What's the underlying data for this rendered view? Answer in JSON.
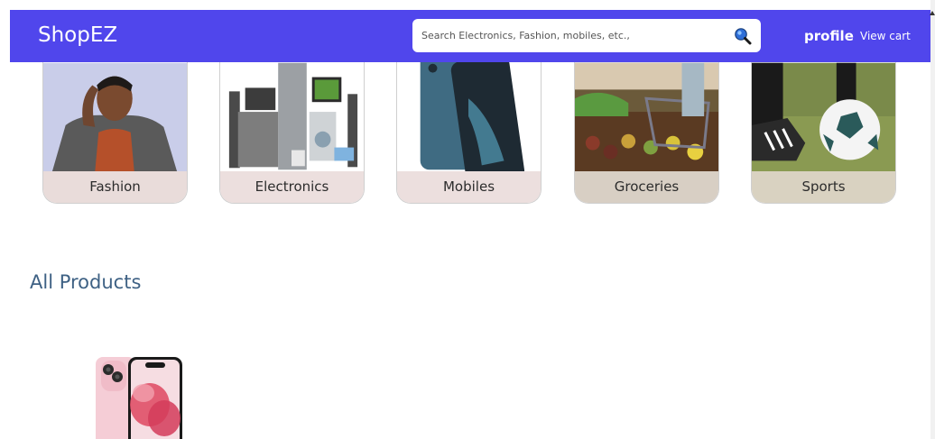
{
  "header": {
    "brand": "ShopEZ",
    "search_placeholder": "Search Electronics, Fashion, mobiles, etc.,",
    "profile_label": "profile",
    "cart_label": "View cart"
  },
  "categories": [
    {
      "label": "Fashion"
    },
    {
      "label": "Electronics"
    },
    {
      "label": "Mobiles"
    },
    {
      "label": "Groceries"
    },
    {
      "label": "Sports"
    }
  ],
  "products_section": {
    "title": "All Products"
  },
  "colors": {
    "navbar": "#5046ec",
    "section_title": "#3e6184"
  },
  "icons": {
    "search": "magnifier-icon"
  }
}
